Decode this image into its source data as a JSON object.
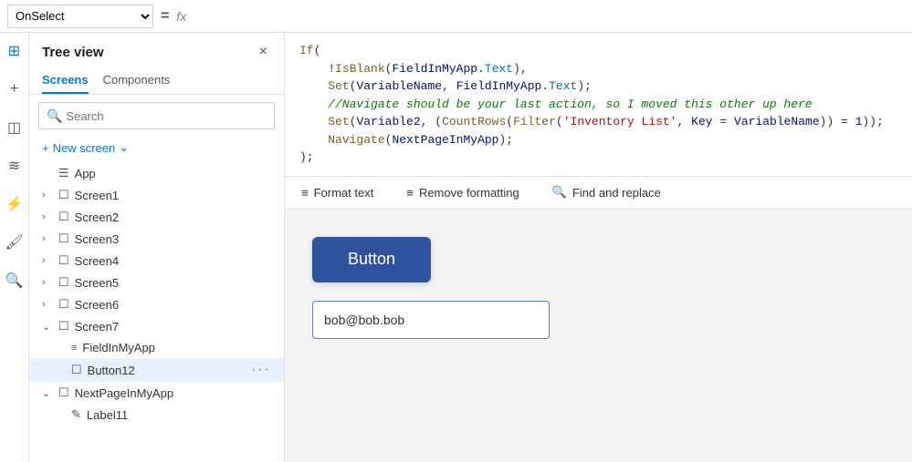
{
  "topbar": {
    "select_value": "OnSelect",
    "equals_label": "=",
    "fx_label": "fx"
  },
  "tree": {
    "title": "Tree view",
    "close_label": "×",
    "tabs": [
      {
        "label": "Screens",
        "active": true
      },
      {
        "label": "Components",
        "active": false
      }
    ],
    "search_placeholder": "Search",
    "new_screen_label": "New screen",
    "items": [
      {
        "label": "App",
        "icon": "☰",
        "chevron": "",
        "indent": 0,
        "type": "app"
      },
      {
        "label": "Screen1",
        "icon": "☐",
        "chevron": "›",
        "indent": 0,
        "type": "screen"
      },
      {
        "label": "Screen2",
        "icon": "☐",
        "chevron": "›",
        "indent": 0,
        "type": "screen"
      },
      {
        "label": "Screen3",
        "icon": "☐",
        "chevron": "›",
        "indent": 0,
        "type": "screen"
      },
      {
        "label": "Screen4",
        "icon": "☐",
        "chevron": "›",
        "indent": 0,
        "type": "screen"
      },
      {
        "label": "Screen5",
        "icon": "☐",
        "chevron": "›",
        "indent": 0,
        "type": "screen"
      },
      {
        "label": "Screen6",
        "icon": "☐",
        "chevron": "›",
        "indent": 0,
        "type": "screen"
      },
      {
        "label": "Screen7",
        "icon": "☐",
        "chevron": "⌄",
        "indent": 0,
        "type": "screen"
      },
      {
        "label": "FieldInMyApp",
        "icon": "≡",
        "chevron": "",
        "indent": 1,
        "type": "field"
      },
      {
        "label": "Button12",
        "icon": "☐",
        "chevron": "",
        "indent": 1,
        "type": "button",
        "selected": true,
        "dots": true
      },
      {
        "label": "NextPageInMyApp",
        "icon": "☐",
        "chevron": "⌄",
        "indent": 0,
        "type": "screen"
      },
      {
        "label": "Label11",
        "icon": "✎",
        "chevron": "",
        "indent": 1,
        "type": "label"
      }
    ]
  },
  "code": {
    "line1": "If(",
    "line2": "    !IsBlank(FieldInMyApp.Text),",
    "line3": "    Set(VariableName, FieldInMyApp.Text);",
    "line4": "    //Navigate should be your last action, so I moved this other up here",
    "line5": "    Set(Variable2, (CountRows(Filter('Inventory List', Key = VariableName)) = 1));",
    "line6": "    Navigate(NextPageInMyApp);",
    "line7": ");"
  },
  "toolbar": {
    "format_text": "Format text",
    "remove_formatting": "Remove formatting",
    "find_replace": "Find and replace"
  },
  "canvas": {
    "button_label": "Button",
    "input_value": "bob@bob.bob"
  },
  "icons": {
    "search": "🔍",
    "layers": "⊞",
    "add": "+",
    "components": "◫",
    "variables": "≋",
    "connections": "⚡",
    "settings": "⚙",
    "find": "🔍"
  }
}
